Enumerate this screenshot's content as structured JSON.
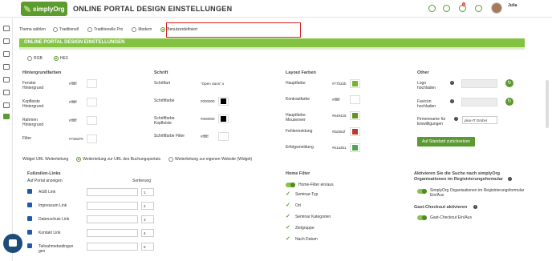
{
  "header": {
    "brand": "simplyOrg",
    "title": "ONLINE PORTAL DESIGN EINSTELLUNGEN",
    "notif_count": "5",
    "user": "Julia"
  },
  "theme": {
    "label": "Thema wählen",
    "options": [
      "Traditionell",
      "Traditionelle Pro",
      "Modern",
      "Benutzerdefiniert"
    ],
    "selected": "Benutzerdefiniert"
  },
  "section": {
    "title": "ONLINE PORTAL DESIGN EINSTELLUNGEN"
  },
  "colormode": {
    "options": [
      "RGB",
      "HEX"
    ],
    "selected": "HEX"
  },
  "bg": {
    "title": "Hintergrundfarben",
    "rows": [
      {
        "label": "Fenster\nHintergrund",
        "value": "#ffffff",
        "color": "#ffffff"
      },
      {
        "label": "Kopfleiste\nHintergrund",
        "value": "#ffffff",
        "color": "#ffffff"
      },
      {
        "label": "Rahmen\nHintergrund",
        "value": "#ffffff",
        "color": "#ffffff"
      },
      {
        "label": "Filter",
        "value": "#736d70",
        "color": "#ffffff"
      }
    ]
  },
  "font": {
    "title": "Schrift",
    "rows": [
      {
        "label": "Schriftart",
        "value": "\"Open Sans\",s",
        "color": ""
      },
      {
        "label": "Schriftfarbe",
        "value": "#000000",
        "color": "#000000"
      },
      {
        "label": "Schriftfarbe\nKopfleiste",
        "value": "#000000",
        "color": "#000000"
      },
      {
        "label": "Schriftfarbe Filter",
        "value": "#ffffff",
        "color": "#ffffff"
      }
    ]
  },
  "layout": {
    "title": "Layout Farben",
    "rows": [
      {
        "label": "Hauptfarbe",
        "value": "#77b32b",
        "color": "#77b32b"
      },
      {
        "label": "Kontrastfarbe",
        "value": "#ffffff",
        "color": "#ffffff"
      },
      {
        "label": "Hauptfarbe\nMouseover",
        "value": "#649425",
        "color": "#649425"
      },
      {
        "label": "Fehlermeldung",
        "value": "#bd362f",
        "color": "#bd362f"
      },
      {
        "label": "Erfolgsmeldung",
        "value": "#51a351",
        "color": "#51a351"
      }
    ]
  },
  "other": {
    "title": "Other",
    "rows": [
      {
        "label": "Logo\nhochladen"
      },
      {
        "label": "Favicon\nhochladen"
      }
    ],
    "company_label": "Firmenname für\nEinwilligungen",
    "company_value": "plus-IT GmbH",
    "reset_button": "Auf Standard zurücksetzen"
  },
  "widget": {
    "label": "Widget URL Weiterleitung",
    "options": [
      "Weiterleitung zur URL des Buchungsportals",
      "Weiterleitung zur eigenen Website (Widget)"
    ],
    "selected": "Weiterleitung zur URL des Buchungsportals"
  },
  "footer": {
    "title": "Fußzeilen-Links",
    "col1": "Auf Portal anzeigen",
    "col2": "Sortierung",
    "rows": [
      {
        "label": "AGB Link",
        "sort": "1"
      },
      {
        "label": "Impressum Link",
        "sort": "2"
      },
      {
        "label": "Datenschutz Link",
        "sort": "3"
      },
      {
        "label": "Kontakt Link",
        "sort": "4"
      },
      {
        "label": "Teilnahmebedingun\ngen",
        "sort": "5"
      }
    ]
  },
  "homefilter": {
    "title": "Home Filter",
    "toggle_label": "Home-Filter ein/aus",
    "items": [
      "Seminar-Typ",
      "Ort",
      "Seminar Kategorien",
      "Zielgruppe",
      "Nach Datum"
    ]
  },
  "search": {
    "title": "Aktivieren Sie die Suche nach simplyOrg\nOrganisationen im Registrierungsformular",
    "toggle_label": "SimplyOrg Organisationen im Registrierungsformular\nEin/Aus",
    "guest_title": "Gast-Checkout aktivieren",
    "guest_toggle": "Gast-Checkout Ein/Aus"
  }
}
